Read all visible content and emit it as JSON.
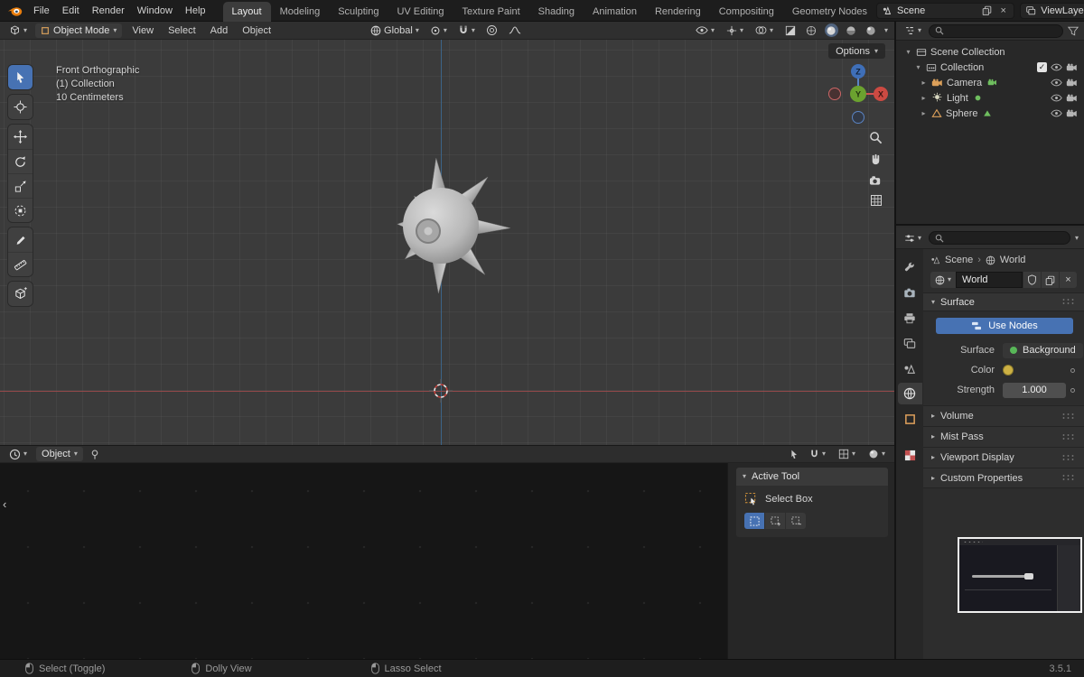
{
  "topbar": {
    "menus": [
      "File",
      "Edit",
      "Render",
      "Window",
      "Help"
    ],
    "tabs": [
      "Layout",
      "Modeling",
      "Sculpting",
      "UV Editing",
      "Texture Paint",
      "Shading",
      "Animation",
      "Rendering",
      "Compositing",
      "Geometry Nodes"
    ],
    "active_tab": "Layout",
    "scene_label": "Scene",
    "viewlayer_label": "ViewLayer"
  },
  "viewport": {
    "header": {
      "mode": "Object Mode",
      "menus": [
        "View",
        "Select",
        "Add",
        "Object"
      ],
      "orientation": "Global",
      "options_label": "Options"
    },
    "overlay": {
      "line1": "Front Orthographic",
      "line2": "(1) Collection",
      "line3": "10 Centimeters"
    },
    "gizmo": {
      "x": "X",
      "y": "Y",
      "z": "Z"
    }
  },
  "outliner": {
    "scene_collection": "Scene Collection",
    "collection": "Collection",
    "items": [
      {
        "name": "Camera"
      },
      {
        "name": "Light"
      },
      {
        "name": "Sphere"
      }
    ]
  },
  "properties": {
    "breadcrumb": {
      "scene": "Scene",
      "world": "World"
    },
    "world_name": "World",
    "surface_panel": "Surface",
    "use_nodes": "Use Nodes",
    "surface_label": "Surface",
    "surface_value": "Background",
    "color_label": "Color",
    "strength_label": "Strength",
    "strength_value": "1.000",
    "panels": [
      "Volume",
      "Mist Pass",
      "Viewport Display",
      "Custom Properties"
    ]
  },
  "timeline": {
    "mode": "Object",
    "active_tool_title": "Active Tool",
    "active_tool_name": "Select Box"
  },
  "statusbar": {
    "items": [
      "Select (Toggle)",
      "Dolly View",
      "Lasso Select"
    ],
    "version": "3.5.1"
  },
  "icons": {
    "caret_down": "▾",
    "tri_down": "▾",
    "tri_right": "▸",
    "chevron_right": "›",
    "chevron_left": "‹",
    "close": "×",
    "check": "✓"
  },
  "colors": {
    "accent": "#4772b3",
    "axis_x": "#93494a",
    "axis_z": "#3c6488",
    "viewport_bg": "#3b3b3b",
    "panel_bg": "#2d2d2d",
    "topbar_bg": "#1d1d1d"
  }
}
